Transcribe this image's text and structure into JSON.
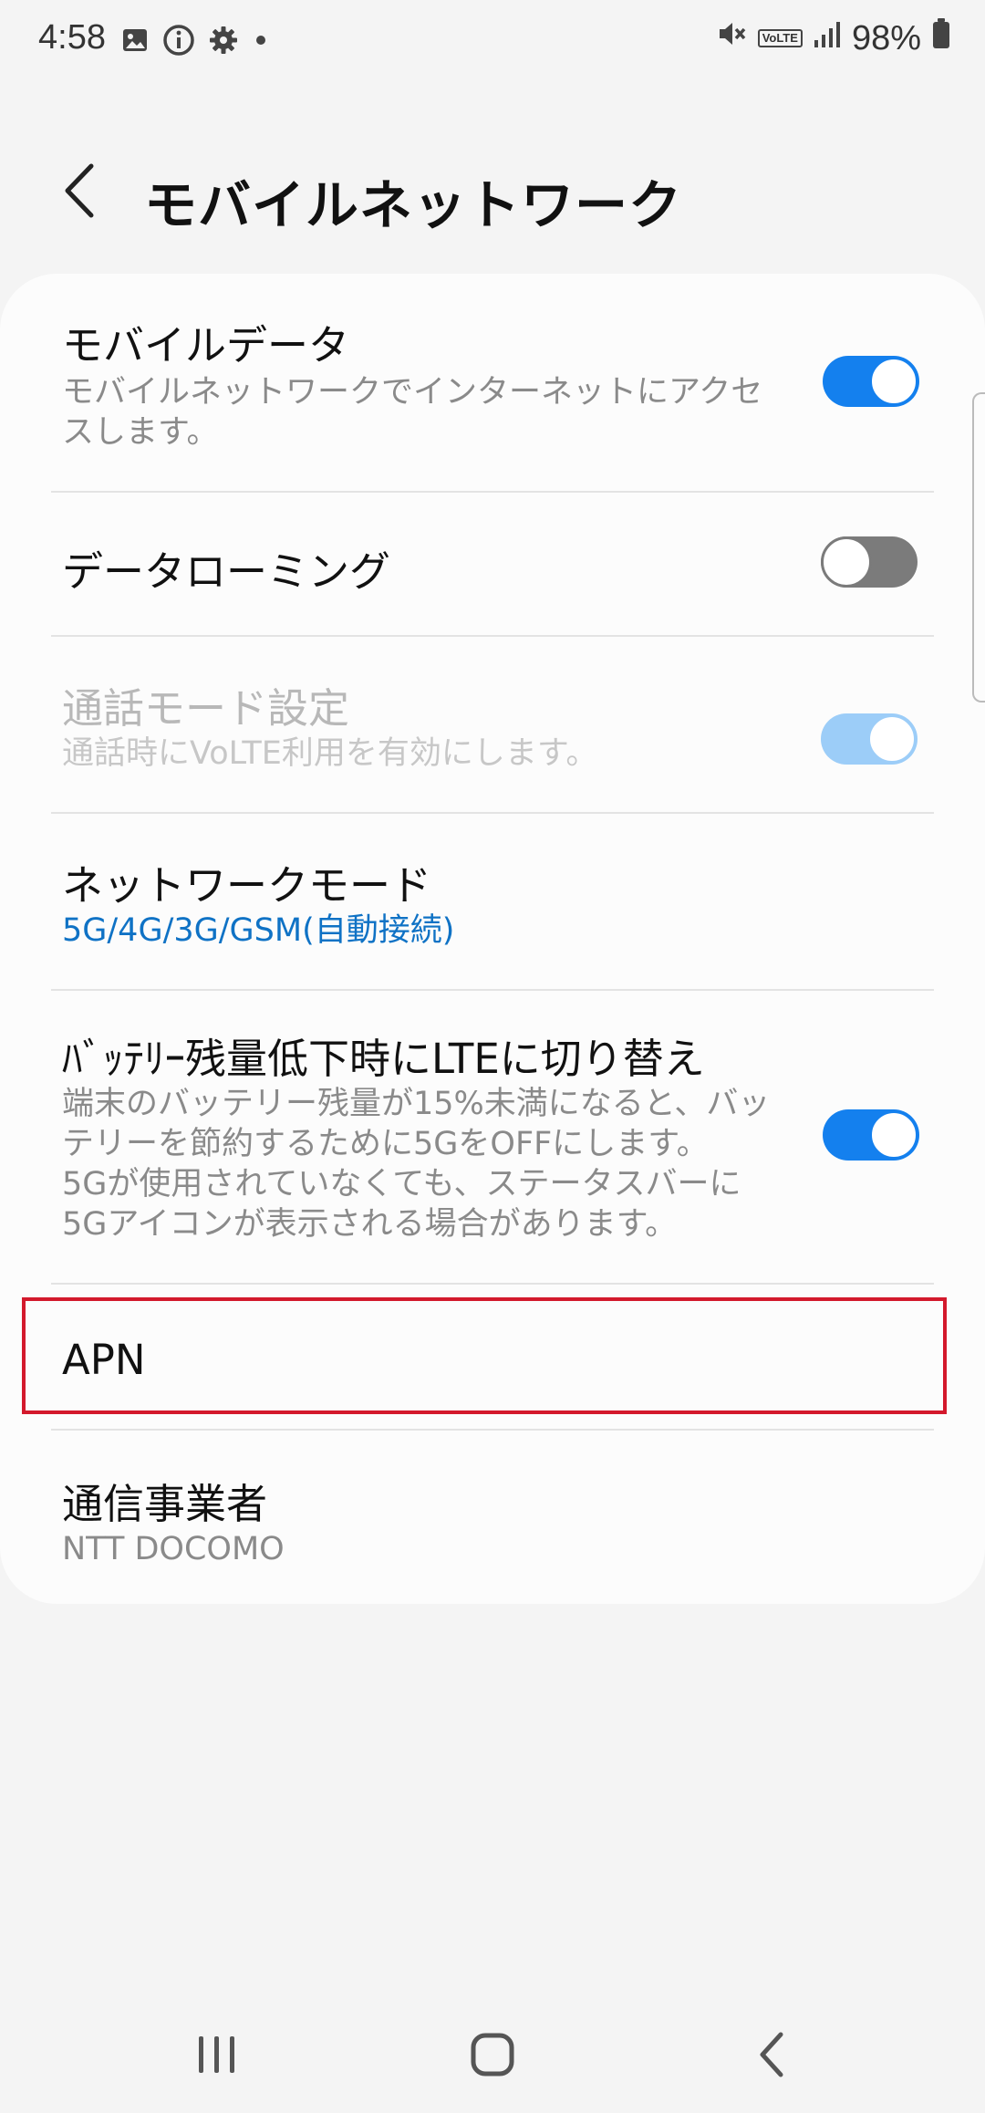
{
  "status_bar": {
    "time": "4:58",
    "battery": "98%",
    "volte": "VoLTE",
    "left_icons": [
      "image-icon",
      "info-icon",
      "gear-icon",
      "dot-icon"
    ],
    "right_icons": [
      "mute-icon",
      "volte-icon",
      "signal-icon",
      "battery-icon"
    ]
  },
  "header": {
    "title": "モバイルネットワーク",
    "back_icon": "chevron-left-icon"
  },
  "settings": {
    "mobile_data": {
      "title": "モバイルデータ",
      "subtitle_line1": "モバイルネットワークでインターネットにアクセ",
      "subtitle_line2": "スします。",
      "toggle": "on"
    },
    "data_roaming": {
      "title": "データローミング",
      "toggle": "off"
    },
    "call_mode": {
      "title": "通話モード設定",
      "subtitle": "通話時にVoLTE利用を有効にします。",
      "toggle": "on",
      "enabled": false
    },
    "network_mode": {
      "title": "ネットワークモード",
      "value": "5G/4G/3G/GSM(自動接続)"
    },
    "battery_lte": {
      "title": "ﾊﾞｯﾃﾘｰ残量低下時にLTEに切り替え",
      "subtitle_line1": "端末のバッテリー残量が15%未満になると、バッ",
      "subtitle_line2": "テリーを節約するために5GをOFFにします。",
      "subtitle_line3": "5Gが使用されていなくても、ステータスバーに",
      "subtitle_line4": "5Gアイコンが表示される場合があります。",
      "toggle": "on"
    },
    "apn": {
      "title": "APN"
    },
    "carrier": {
      "title": "通信事業者",
      "value": "NTT DOCOMO"
    }
  },
  "colors": {
    "accent": "#1480ee",
    "highlight_border": "#d3192c",
    "link_blue": "#0f72c5",
    "background": "#f4f4f4"
  },
  "nav_bar": {
    "buttons": [
      "recent-apps-icon",
      "home-icon",
      "back-icon"
    ]
  }
}
